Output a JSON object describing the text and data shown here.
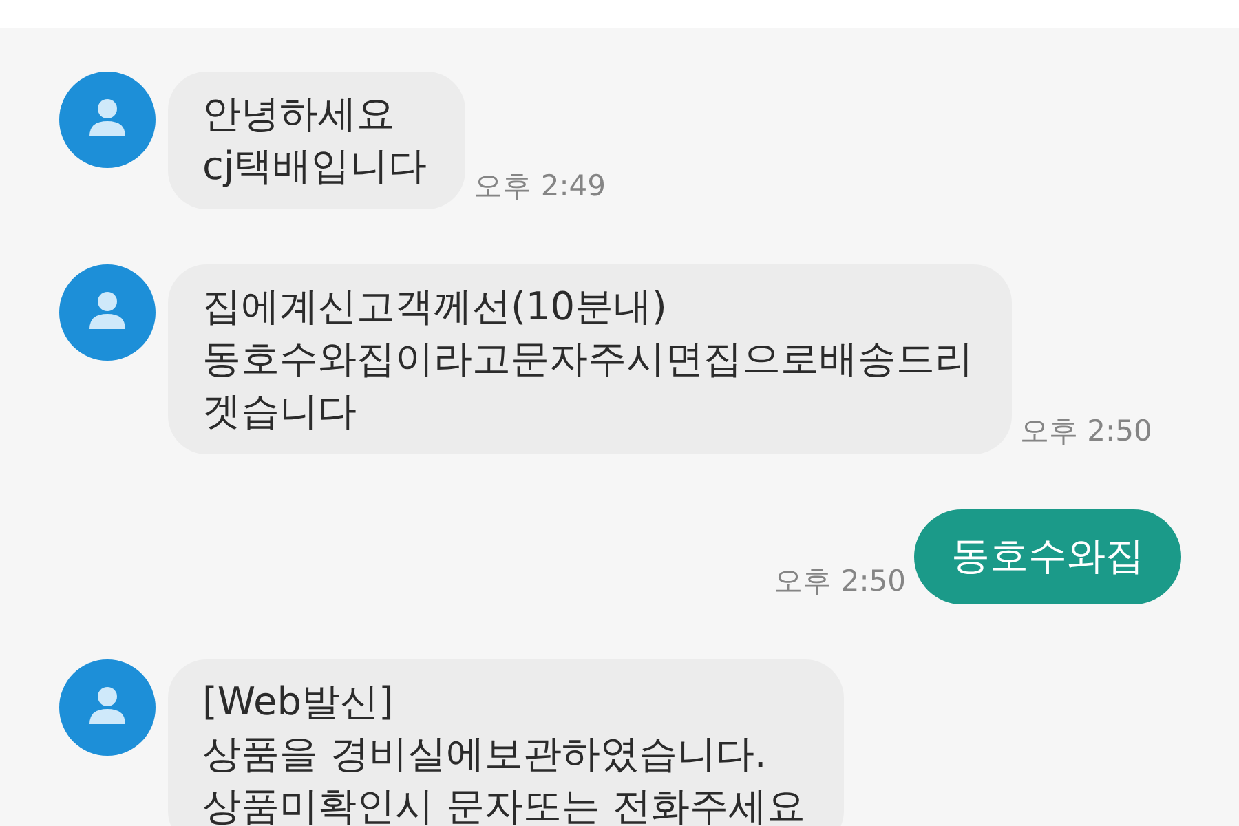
{
  "messages": [
    {
      "kind": "incoming",
      "lines": [
        "안녕하세요",
        "cj택배입니다"
      ],
      "time": "오후 2:49"
    },
    {
      "kind": "incoming",
      "lines": [
        "집에계신고객께선(10분내)",
        "동호수와집이라고문자주시면집으로배송드리",
        "겟습니다"
      ],
      "time": "오후 2:50"
    },
    {
      "kind": "outgoing",
      "lines": [
        "동호수와집"
      ],
      "time": "오후 2:50"
    },
    {
      "kind": "incoming",
      "lines": [
        "[Web발신]",
        "상품을 경비실에보관하였습니다.",
        "상품미확인시 문자또는 전화주세요"
      ]
    }
  ]
}
